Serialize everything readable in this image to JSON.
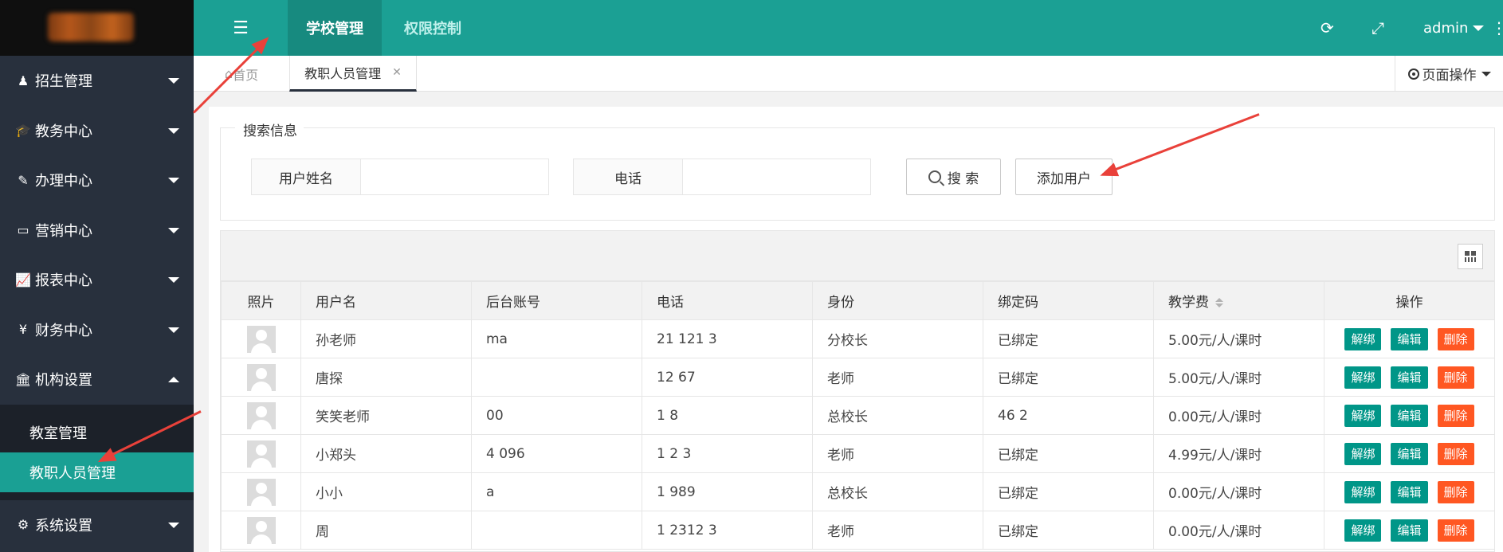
{
  "sidebar": {
    "items": [
      {
        "icon": "person-icon",
        "glyph": "♟",
        "label": "招生管理",
        "caret": "down"
      },
      {
        "icon": "graduation-cap-icon",
        "glyph": "🎓",
        "label": "教务中心",
        "caret": "down"
      },
      {
        "icon": "edit-icon",
        "glyph": "✎",
        "label": "办理中心",
        "caret": "down"
      },
      {
        "icon": "laptop-icon",
        "glyph": "▭",
        "label": "营销中心",
        "caret": "down"
      },
      {
        "icon": "line-chart-icon",
        "glyph": "📈",
        "label": "报表中心",
        "caret": "down"
      },
      {
        "icon": "yen-icon",
        "glyph": "¥",
        "label": "财务中心",
        "caret": "down"
      },
      {
        "icon": "bank-icon",
        "glyph": "🏛",
        "label": "机构设置",
        "caret": "up"
      }
    ],
    "sub_items": [
      {
        "label": "教室管理",
        "active": false
      },
      {
        "label": "教职人员管理",
        "active": true
      }
    ],
    "last_item": {
      "icon": "cogs-icon",
      "glyph": "⚙",
      "label": "系统设置",
      "caret": "down"
    }
  },
  "topbar": {
    "menu_glyph": "☰",
    "tabs": [
      {
        "label": "学校管理",
        "active": true
      },
      {
        "label": "权限控制",
        "active": false
      }
    ],
    "refresh_glyph": "⟳",
    "fullscreen_glyph": "⤢",
    "user": "admin",
    "more_glyph": "⋮"
  },
  "tabstrip": {
    "home_label": "首页",
    "home_glyph": "⌂",
    "active_tab": "教职人员管理",
    "close_glyph": "✕",
    "page_ops": "页面操作"
  },
  "search": {
    "legend": "搜索信息",
    "username_label": "用户姓名",
    "username_value": "",
    "phone_label": "电话",
    "phone_value": "",
    "search_button": "搜 索",
    "add_button": "添加用户"
  },
  "table": {
    "headers": [
      "照片",
      "用户名",
      "后台账号",
      "电话",
      "身份",
      "绑定码",
      "教学费",
      "操作"
    ],
    "rows": [
      {
        "name": "孙老师",
        "account": "ma",
        "phone": "21 121 3",
        "role": "分校长",
        "bind": "已绑定",
        "fee": "5.00元/人/课时"
      },
      {
        "name": "唐探",
        "account": "",
        "phone": "12 67",
        "role": "老师",
        "bind": "已绑定",
        "fee": "5.00元/人/课时"
      },
      {
        "name": "笑笑老师",
        "account": "00",
        "phone": "1 8",
        "role": "总校长",
        "bind": "46 2",
        "fee": "0.00元/人/课时"
      },
      {
        "name": "小郑头",
        "account": "4 096",
        "phone": "1 2 3",
        "role": "老师",
        "bind": "已绑定",
        "fee": "4.99元/人/课时"
      },
      {
        "name": "小小",
        "account": "a",
        "phone": "1 989",
        "role": "总校长",
        "bind": "已绑定",
        "fee": "0.00元/人/课时"
      },
      {
        "name": "周",
        "account": "",
        "phone": "1 2312 3",
        "role": "老师",
        "bind": "已绑定",
        "fee": "0.00元/人/课时"
      }
    ],
    "ops": {
      "unbind": "解绑",
      "edit": "编辑",
      "delete": "删除"
    }
  },
  "colors": {
    "accent": "#1ba094",
    "sidebar_bg": "#28303d",
    "op_green": "#009688",
    "op_red": "#ff5722",
    "annotation_arrow": "#e9413a"
  }
}
